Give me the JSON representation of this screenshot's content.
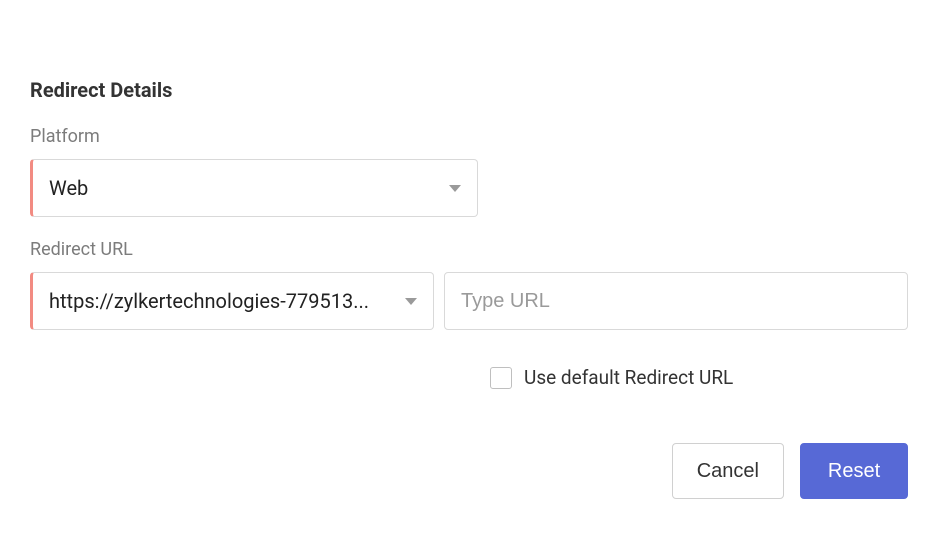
{
  "section": {
    "title": "Redirect Details"
  },
  "platform": {
    "label": "Platform",
    "value": "Web"
  },
  "redirect": {
    "label": "Redirect URL",
    "select_value": "https://zylkertechnologies-779513...",
    "url_placeholder": "Type URL",
    "url_value": ""
  },
  "checkbox": {
    "default_label": "Use default Redirect URL",
    "default_checked": false
  },
  "buttons": {
    "cancel": "Cancel",
    "reset": "Reset"
  }
}
